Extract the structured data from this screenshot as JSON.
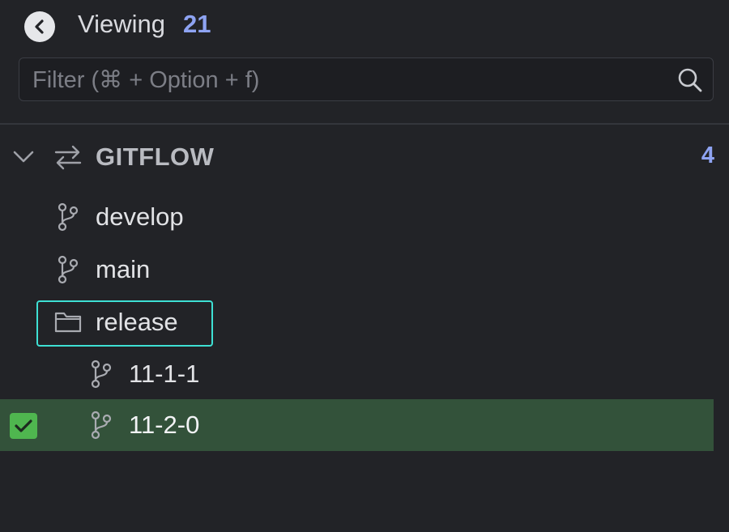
{
  "header": {
    "viewing_label": "Viewing",
    "viewing_count": "21"
  },
  "filter": {
    "placeholder": "Filter (⌘ + Option + f)",
    "value": ""
  },
  "group": {
    "label": "GITFLOW",
    "count": "4",
    "expanded": true
  },
  "items": [
    {
      "type": "branch",
      "label": "develop"
    },
    {
      "type": "branch",
      "label": "main"
    },
    {
      "type": "folder",
      "label": "release"
    },
    {
      "type": "branch",
      "label": "11-1-1"
    },
    {
      "type": "branch",
      "label": "11-2-0",
      "selected": true,
      "checked": true
    }
  ],
  "colors": {
    "background": "#222327",
    "accent_count": "#8ea3f2",
    "selected_row": "#33523a",
    "checkbox": "#4fb64f",
    "focus_outline": "#3ee0d4"
  },
  "icons": {
    "back": "chevron-left-circle",
    "search": "magnifier",
    "group_toggle": "chevron-down",
    "group_type": "swap-arrows",
    "branch": "git-branch",
    "folder": "folder-outline",
    "check": "checkmark"
  }
}
